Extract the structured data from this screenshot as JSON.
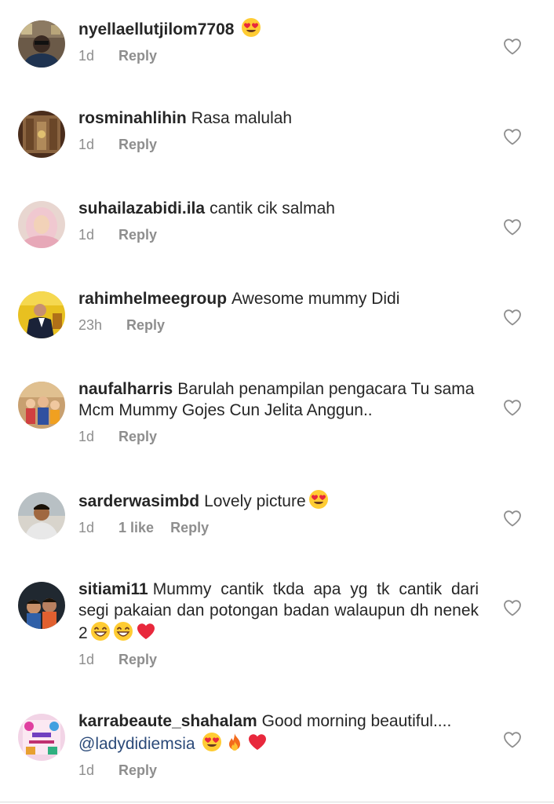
{
  "comments": [
    {
      "username": "nyellaellutjilom7708",
      "text": "",
      "emojis": [
        "heart-eyes"
      ],
      "time": "1d",
      "likes": "",
      "reply": "Reply"
    },
    {
      "username": "rosminahlihin",
      "text": "Rasa malulah",
      "emojis": [],
      "time": "1d",
      "likes": "",
      "reply": "Reply"
    },
    {
      "username": "suhailazabidi.ila",
      "text": "cantik cik salmah",
      "emojis": [],
      "time": "1d",
      "likes": "",
      "reply": "Reply"
    },
    {
      "username": "rahimhelmeegroup",
      "text": "Awesome mummy Didi",
      "emojis": [],
      "time": "23h",
      "likes": "",
      "reply": "Reply"
    },
    {
      "username": "naufalharris",
      "text": "Barulah penampilan pengacara Tu sama Mcm Mummy Gojes Cun Jelita Anggun..",
      "emojis": [],
      "time": "1d",
      "likes": "",
      "reply": "Reply"
    },
    {
      "username": "sarderwasimbd",
      "text": "Lovely picture",
      "emojis": [
        "heart-eyes"
      ],
      "time": "1d",
      "likes": "1 like",
      "reply": "Reply"
    },
    {
      "username": "sitiami11",
      "text": "Mummy  cantik  tkda  apa  yg  tk  cantik  dari  segi  pakaian  dan  potongan  badan  walaupun  dh  nenek 2",
      "emojis": [
        "grin",
        "grin",
        "red-heart"
      ],
      "time": "1d",
      "likes": "",
      "reply": "Reply"
    },
    {
      "username": "karrabeaute_shahalam",
      "text": "Good morning beautiful....",
      "mention": "@ladydidiemsia",
      "emojis": [
        "heart-eyes",
        "fire",
        "red-heart"
      ],
      "time": "1d",
      "likes": "",
      "reply": "Reply"
    }
  ],
  "icons": {
    "like": "heart-outline-icon"
  },
  "colors": {
    "text": "#262626",
    "secondary": "#8e8e8e",
    "mention": "#2b4a79",
    "heart_outline": "#8e8e8e"
  }
}
